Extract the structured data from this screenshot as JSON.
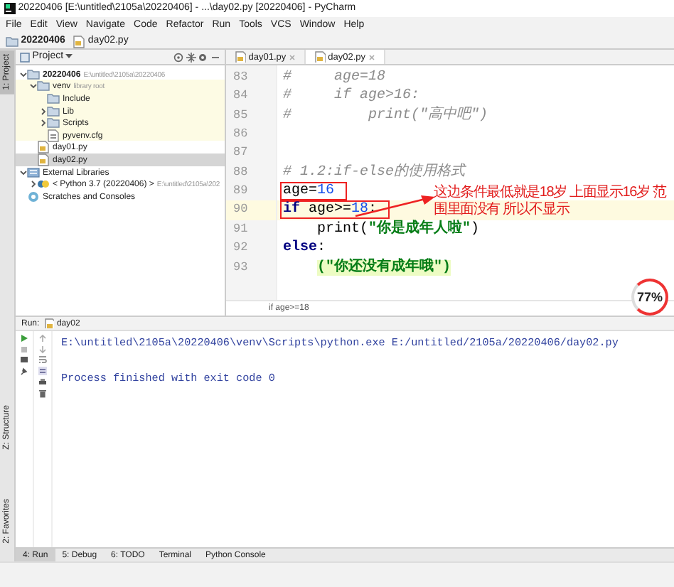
{
  "window": {
    "title": "20220406 [E:\\untitled\\2105a\\20220406] - ...\\day02.py [20220406] - PyCharm"
  },
  "menu": [
    "File",
    "Edit",
    "View",
    "Navigate",
    "Code",
    "Refactor",
    "Run",
    "Tools",
    "VCS",
    "Window",
    "Help"
  ],
  "nav_path": [
    {
      "label": "20220406",
      "kind": "folder"
    },
    {
      "label": "day02.py",
      "kind": "file"
    }
  ],
  "left_stripe": [
    {
      "label": "1: Project",
      "selected": true
    },
    {
      "label": "Z: Structure",
      "selected": false
    },
    {
      "label": "2: Favorites",
      "selected": false
    }
  ],
  "project_panel": {
    "title": "Project",
    "tree": [
      {
        "label": "20220406",
        "hint": "E:\\untitled\\2105a\\20220406",
        "kind": "folder",
        "expanded": true,
        "selected": false,
        "children": [
          {
            "label": "venv",
            "hint": "library root",
            "kind": "folder",
            "expanded": true,
            "selected": false,
            "library_root": true,
            "children": [
              {
                "label": "Include",
                "kind": "folder",
                "selected": false
              },
              {
                "label": "Lib",
                "kind": "folder",
                "expanded": false,
                "selected": false
              },
              {
                "label": "Scripts",
                "kind": "folder",
                "expanded": false,
                "selected": false
              },
              {
                "label": "pyvenv.cfg",
                "kind": "config",
                "selected": false
              }
            ]
          },
          {
            "label": "day01.py",
            "kind": "file",
            "selected": false
          },
          {
            "label": "day02.py",
            "kind": "file",
            "selected": true
          }
        ]
      },
      {
        "label": "External Libraries",
        "kind": "library",
        "expanded": true,
        "selected": false,
        "children": [
          {
            "label": "< Python 3.7 (20220406) >",
            "hint": "E:\\untitled\\2105a\\202",
            "kind": "python",
            "expanded": false,
            "selected": false
          }
        ]
      },
      {
        "label": "Scratches and Consoles",
        "kind": "scratch",
        "selected": false
      }
    ]
  },
  "editor": {
    "tabs": [
      {
        "label": "day01.py",
        "selected": false
      },
      {
        "label": "day02.py",
        "selected": true
      }
    ],
    "lines": [
      {
        "number": "83",
        "current": false,
        "tokens": [
          {
            "kind": "comment",
            "text": "#     age=18"
          }
        ]
      },
      {
        "number": "84",
        "current": false,
        "tokens": [
          {
            "kind": "comment",
            "text": "#     if age>16:"
          }
        ]
      },
      {
        "number": "85",
        "current": false,
        "tokens": [
          {
            "kind": "comment",
            "text": "#         print(\"高中吧\")"
          }
        ]
      },
      {
        "number": "86",
        "current": false
      },
      {
        "number": "87",
        "current": false
      },
      {
        "number": "88",
        "current": false,
        "tokens": [
          {
            "kind": "comment",
            "text": "# 1.2:if-else的使用格式"
          }
        ]
      },
      {
        "number": "89",
        "current": false,
        "boxed": true,
        "tokens": [
          {
            "kind": "plain",
            "text": "age="
          },
          {
            "kind": "number",
            "text": "16"
          }
        ]
      },
      {
        "number": "90",
        "current": true,
        "boxed": true,
        "tokens": [
          {
            "kind": "keyword",
            "text": "if "
          },
          {
            "kind": "plain",
            "text": "age>="
          },
          {
            "kind": "number",
            "text": "18"
          },
          {
            "kind": "plain",
            "text": ":"
          }
        ]
      },
      {
        "number": "91",
        "current": false,
        "indented": true,
        "tokens": [
          {
            "kind": "plain",
            "text": "print("
          },
          {
            "kind": "string",
            "text": "\"你是成年人啦\""
          },
          {
            "kind": "plain",
            "text": ")"
          }
        ]
      },
      {
        "number": "92",
        "current": false,
        "tokens": [
          {
            "kind": "keyword",
            "text": "else"
          },
          {
            "kind": "plain",
            "text": ":"
          }
        ]
      },
      {
        "number": "93",
        "current": false,
        "indented": true,
        "tokens": [
          {
            "kind": "marked",
            "text": "(\"你还没有成年哦\")"
          }
        ]
      }
    ],
    "breadcrumb": "if age>=18"
  },
  "annotation": {
    "text": "这边条件最低就是18岁 上面显示16岁 范围里面没有 所以不显示"
  },
  "memory_badge": {
    "label": "77%"
  },
  "run_panel": {
    "title": "Run:",
    "tab": "day02",
    "output": [
      "E:\\untitled\\2105a\\20220406\\venv\\Scripts\\python.exe E:/untitled/2105a/20220406/day02.py",
      "Process finished with exit code 0"
    ]
  },
  "tool_tabs": [
    {
      "label": "4: Run",
      "selected": true
    },
    {
      "label": "5: Debug",
      "selected": false
    },
    {
      "label": "6: TODO",
      "selected": false
    },
    {
      "label": "Terminal",
      "selected": false
    },
    {
      "label": "Python Console",
      "selected": false
    }
  ]
}
